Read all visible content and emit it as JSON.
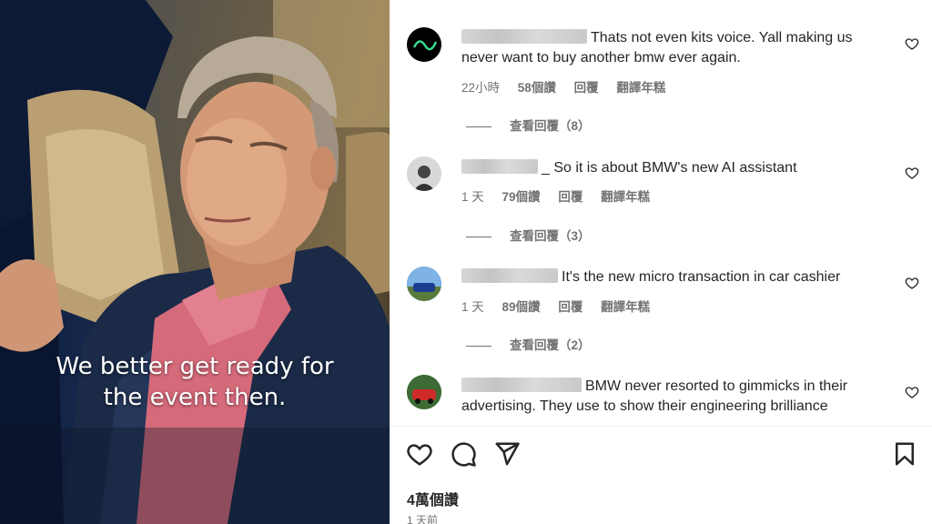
{
  "media": {
    "caption_line1": "We better get ready for",
    "caption_line2": "the event then."
  },
  "comments": [
    {
      "text": "Thats not even kits voice. Yall making us never want to buy another bmw ever again.",
      "time": "22小時",
      "likes": "58個讚",
      "reply": "回覆",
      "translate": "翻譯年糕",
      "view_replies": "查看回覆（8）"
    },
    {
      "text": "_ So it is about BMW's new AI assistant",
      "time": "1 天",
      "likes": "79個讚",
      "reply": "回覆",
      "translate": "翻譯年糕",
      "view_replies": "查看回覆（3）"
    },
    {
      "text": "It's the new micro transaction in car cashier",
      "time": "1 天",
      "likes": "89個讚",
      "reply": "回覆",
      "translate": "翻譯年糕",
      "view_replies": "查看回覆（2）"
    },
    {
      "text": "BMW never resorted to gimmicks in their advertising. They use to show their engineering brilliance",
      "time": "",
      "likes": "",
      "reply": "",
      "translate": "",
      "view_replies": ""
    }
  ],
  "post": {
    "likes": "4萬個讚",
    "time": "1 天前"
  },
  "icons": {
    "comment_heart": "heart-outline-icon",
    "like": "heart-outline-icon",
    "comment": "speech-bubble-icon",
    "share": "paper-plane-icon",
    "save": "bookmark-icon"
  },
  "colors": {
    "text": "#262626",
    "secondary": "#737373",
    "divider": "#efefef"
  }
}
